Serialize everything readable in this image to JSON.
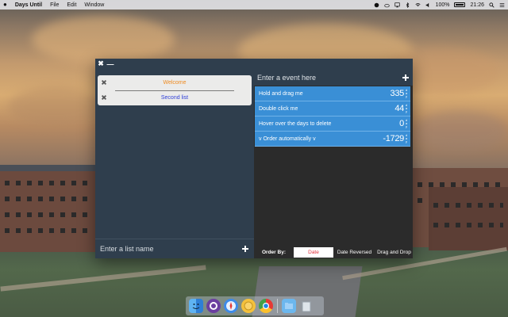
{
  "menubar": {
    "app_name": "Days Until",
    "menus": [
      "File",
      "Edit",
      "Window"
    ],
    "battery": "100%",
    "time": "21:26"
  },
  "window": {
    "close_symbol": "✖",
    "minimize_symbol": "—"
  },
  "lists": {
    "items": [
      {
        "label": "Welcome",
        "color": "#ef8a1f"
      },
      {
        "label": "Second list",
        "color": "#2f3fd8"
      }
    ],
    "input_placeholder": "Enter a list name"
  },
  "events": {
    "input_placeholder": "Enter a event here",
    "items": [
      {
        "name": "Hold and drag me",
        "days": "335"
      },
      {
        "name": "Double click me",
        "days": "44"
      },
      {
        "name": "Hover over the days to delete",
        "days": "0"
      },
      {
        "name": "v Order automatically v",
        "days": "-1729"
      }
    ],
    "unit_letters": [
      "d",
      "a",
      "y"
    ]
  },
  "order": {
    "label": "Order By:",
    "options": [
      "Date",
      "Date Reversed",
      "Drag and Drop"
    ],
    "active": "Date"
  },
  "colors": {
    "event_blue": "#3a8fd6",
    "active_order_red": "#e0313a",
    "window_bg": "#2f3e4d"
  },
  "dock_icons": [
    "finder-icon",
    "github-icon",
    "safari-icon",
    "days-until-icon",
    "chrome-icon",
    "folder-icon",
    "trash-icon"
  ]
}
